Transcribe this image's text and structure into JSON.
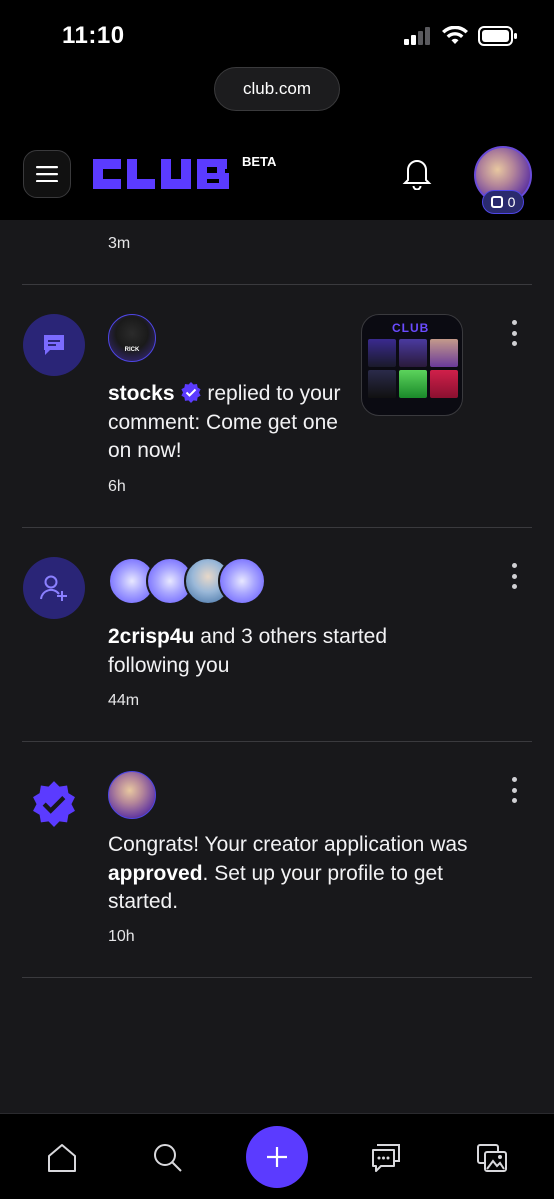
{
  "status_bar": {
    "time": "11:10"
  },
  "browser": {
    "url": "club.com"
  },
  "header": {
    "logo_text": "CLUB",
    "beta_label": "BETA",
    "coin_count": "0"
  },
  "feed": {
    "partial_item": {
      "time": "3m"
    },
    "notifications": [
      {
        "icon": "comment-icon",
        "username": "stocks",
        "verified": true,
        "action_text": " replied to your comment: Come get one on now!",
        "time": "6h",
        "avatar_label": "RICK",
        "thumbnail_logo": "CLUB"
      },
      {
        "icon": "add-user-icon",
        "username": "2crisp4u",
        "action_text": " and 3 others started following you",
        "time": "44m"
      },
      {
        "icon": "verified-badge-icon",
        "text_before": "Congrats! Your creator application was ",
        "text_bold": "approved",
        "text_after": ". Set up your profile to get started.",
        "time": "10h"
      }
    ]
  },
  "bottom_nav": {
    "items": [
      "home-icon",
      "search-icon",
      "add-icon",
      "messages-icon",
      "gallery-icon"
    ]
  },
  "colors": {
    "accent": "#5b3bff",
    "icon_bg": "#2a2577",
    "background": "#18181b"
  }
}
